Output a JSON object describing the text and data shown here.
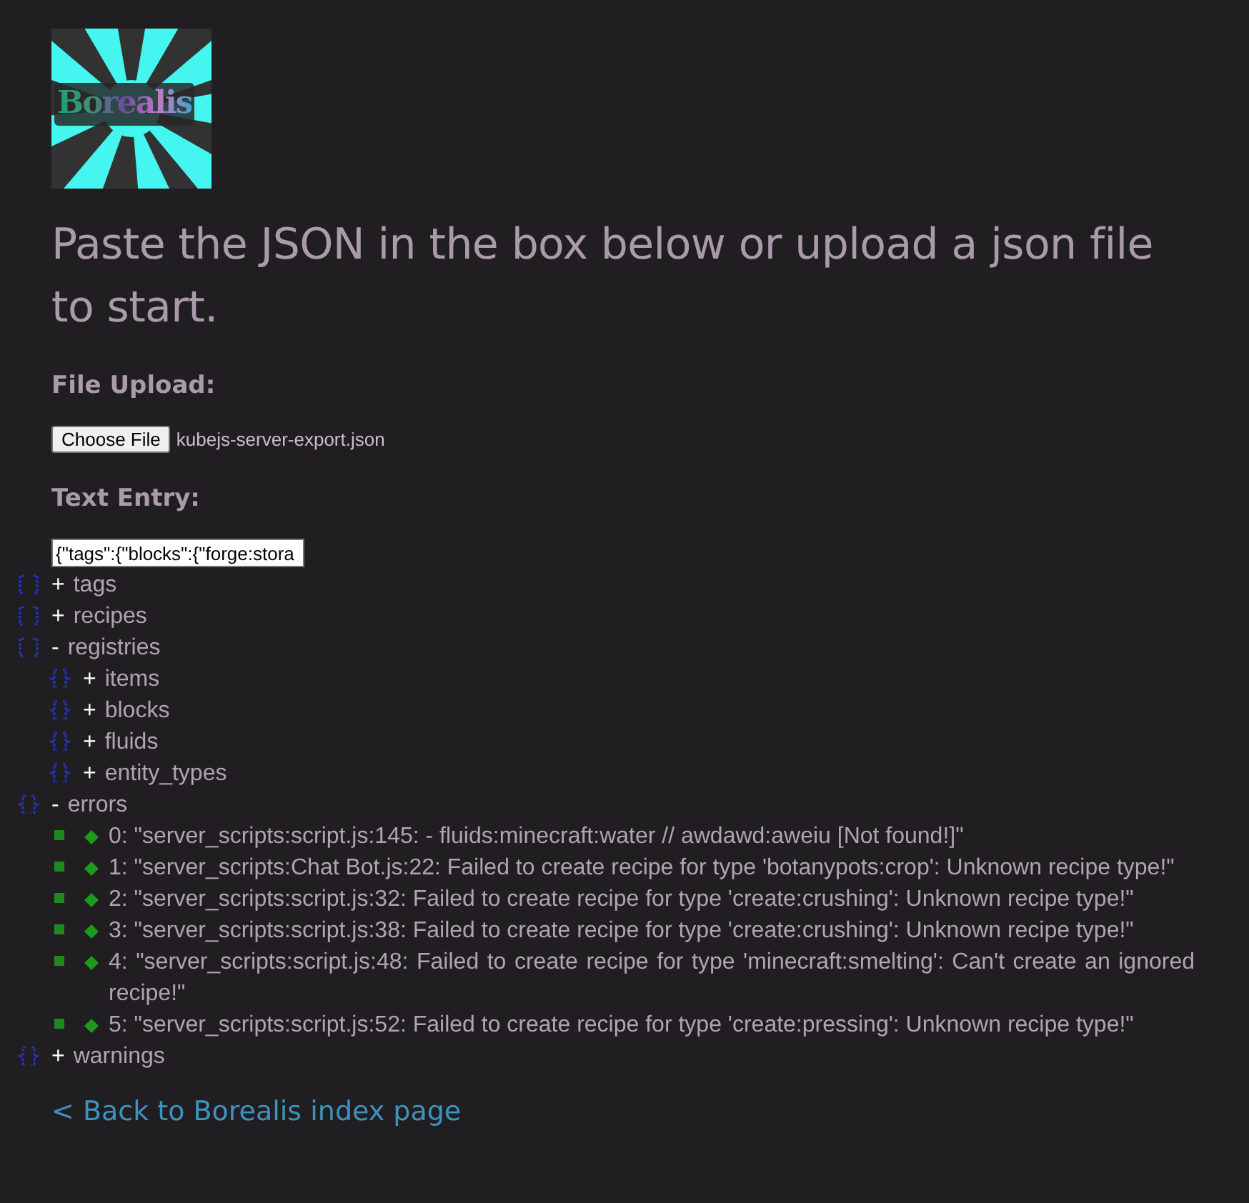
{
  "logo": {
    "text": "Borealis"
  },
  "heading": "Paste the JSON in the box below or upload a json file to start.",
  "file_upload": {
    "label": "File Upload:",
    "button": "Choose File",
    "file_name": "kubejs-server-export.json"
  },
  "text_entry": {
    "label": "Text Entry:",
    "value": "{\"tags\":{\"blocks\":{\"forge:stora"
  },
  "tree": [
    {
      "kind": "array",
      "toggle": "+",
      "label": "tags"
    },
    {
      "kind": "array",
      "toggle": "+",
      "label": "recipes"
    },
    {
      "kind": "array",
      "toggle": "-",
      "label": "registries",
      "children": [
        {
          "kind": "object",
          "toggle": "+",
          "label": "items"
        },
        {
          "kind": "object",
          "toggle": "+",
          "label": "blocks"
        },
        {
          "kind": "object",
          "toggle": "+",
          "label": "fluids"
        },
        {
          "kind": "object",
          "toggle": "+",
          "label": "entity_types"
        }
      ]
    },
    {
      "kind": "object",
      "toggle": "-",
      "label": "errors",
      "children": [
        {
          "kind": "value",
          "label": "0: \"server_scripts:script.js:145: - fluids:minecraft:water // awdawd:aweiu [Not found!]\""
        },
        {
          "kind": "value",
          "label": "1: \"server_scripts:Chat Bot.js:22: Failed to create recipe for type 'botanypots:crop': Unknown recipe type!\""
        },
        {
          "kind": "value",
          "label": "2: \"server_scripts:script.js:32: Failed to create recipe for type 'create:crushing': Unknown recipe type!\""
        },
        {
          "kind": "value",
          "label": "3: \"server_scripts:script.js:38: Failed to create recipe for type 'create:crushing': Unknown recipe type!\""
        },
        {
          "kind": "value",
          "label": "4: \"server_scripts:script.js:48: Failed to create recipe for type 'minecraft:smelting': Can't create an ignored recipe!\""
        },
        {
          "kind": "value",
          "label": "5: \"server_scripts:script.js:52: Failed to create recipe for type 'create:pressing': Unknown recipe type!\""
        }
      ]
    },
    {
      "kind": "object",
      "toggle": "+",
      "label": "warnings"
    }
  ],
  "back_link": "< Back to Borealis index page"
}
